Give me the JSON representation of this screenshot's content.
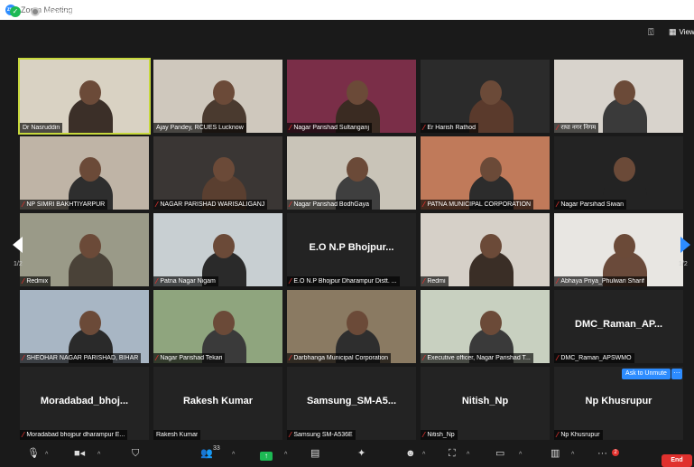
{
  "window": {
    "title": "Zoom Meeting"
  },
  "topbar": {
    "recording_label": "Recording...",
    "view_label": "View"
  },
  "pagination": {
    "left": "1/2",
    "right": "1/2"
  },
  "participants": [
    {
      "name": "Dr Nasruddin",
      "muted": false
    },
    {
      "name": "Ajay Pandey, RCUES Lucknow",
      "muted": false
    },
    {
      "name": "Nagar Parishad Sultanganj",
      "muted": true
    },
    {
      "name": "Er Harish Rathod",
      "muted": true
    },
    {
      "name": "राघा नगर निगम",
      "muted": true
    },
    {
      "name": "NP SIMRI BAKHTIYARPUR",
      "muted": true
    },
    {
      "name": "NAGAR PARISHAD WARISALIGANJ",
      "muted": true
    },
    {
      "name": "Nagar Parishad BodhGaya",
      "muted": true
    },
    {
      "name": "PATNA MUNICIPAL CORPORATION",
      "muted": true
    },
    {
      "name": "Nagar Parsihad Siwan",
      "muted": true
    },
    {
      "name": "Redmix",
      "muted": true
    },
    {
      "name": "Patna Nagar Nigam",
      "muted": true
    },
    {
      "name": "E.O N.P Bhojpur Dharampur Distt. ...",
      "muted": true,
      "big": "E.O N.P Bhojpur..."
    },
    {
      "name": "Redmi",
      "muted": true
    },
    {
      "name": "Abhaya Priya_Phulwari Sharif",
      "muted": true
    },
    {
      "name": "SHEOHAR NAGAR PARISHAD, BIHAR",
      "muted": true
    },
    {
      "name": "Nagar Parishad Tekari",
      "muted": true
    },
    {
      "name": "Darbhanga Municipal Corporation",
      "muted": true
    },
    {
      "name": "Executive officer, Nagar Parishad T...",
      "muted": true
    },
    {
      "name": "DMC_Raman_APSWMO",
      "muted": true,
      "big": "DMC_Raman_AP..."
    },
    {
      "name": "Moradabad bhojpur dharampur E...",
      "muted": true,
      "big": "Moradabad_bhoj..."
    },
    {
      "name": "Rakesh Kumar",
      "muted": false,
      "big": "Rakesh Kumar"
    },
    {
      "name": "Samsung SM-A536E",
      "muted": true,
      "big": "Samsung_SM-A5..."
    },
    {
      "name": "Nitish_Np",
      "muted": true,
      "big": "Nitish_Np"
    },
    {
      "name": "Np Khusrupur",
      "muted": true,
      "big": "Np Khusrupur"
    }
  ],
  "unmute_label": "Ask to Unmute",
  "toolbar": {
    "participant_count": "33",
    "notif_count": "2",
    "end_label": "End"
  },
  "colors": {
    "accent": "#2d8cff",
    "end": "#e0312e",
    "active_speaker": "#c7d83c"
  }
}
